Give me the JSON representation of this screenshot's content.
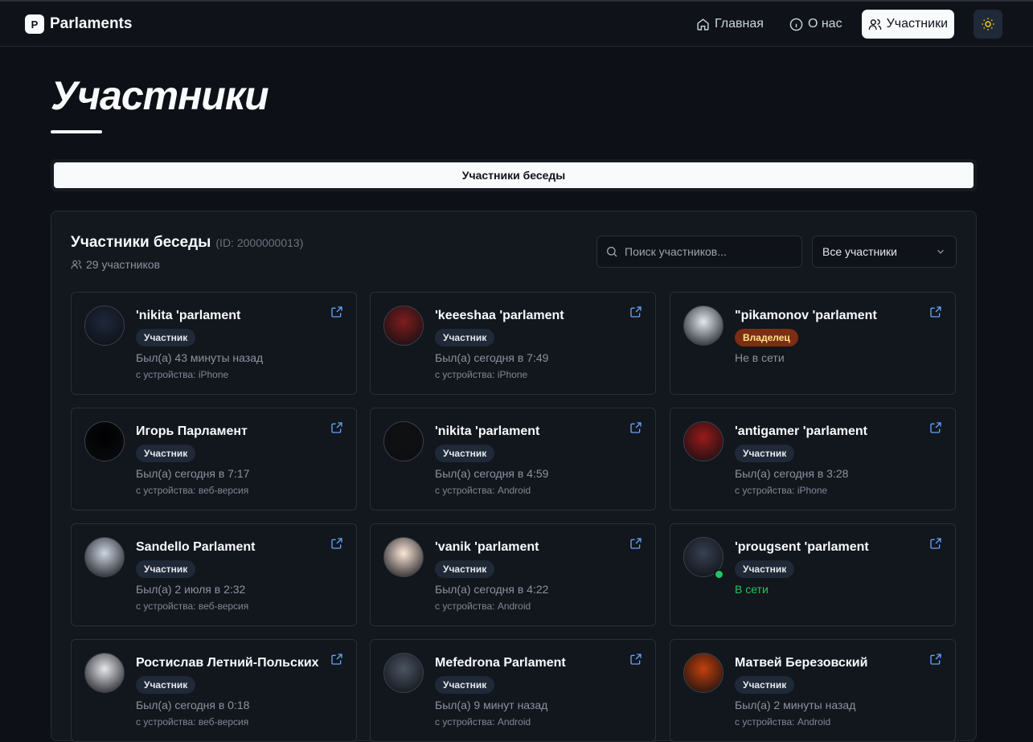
{
  "app": {
    "logo_letter": "P",
    "name": "Parlaments"
  },
  "nav": [
    {
      "label": "Главная",
      "icon": "home-icon"
    },
    {
      "label": "О нас",
      "icon": "info-icon"
    },
    {
      "label": "Участники",
      "icon": "users-icon",
      "active": true
    }
  ],
  "page": {
    "title": "Участники"
  },
  "tabs": [
    {
      "label": "Участники беседы",
      "active": true
    }
  ],
  "panel": {
    "title": "Участники беседы",
    "id_label": "(ID: 2000000013)",
    "count": "29 участников",
    "search_placeholder": "Поиск участников...",
    "filter_value": "Все участники"
  },
  "members": [
    {
      "name": "'nikita 'parlament",
      "role": "Участник",
      "status": "Был(а) 43 минуты назад",
      "device": "с устройства: iPhone",
      "online": false,
      "avatar_color": "#1e293b"
    },
    {
      "name": "'keeeshaa 'parlament",
      "role": "Участник",
      "status": "Был(а) сегодня в 7:49",
      "device": "с устройства: iPhone",
      "online": false,
      "avatar_color": "#7f1d1d"
    },
    {
      "name": "\"pikamonov 'parlament",
      "role": "Владелец",
      "owner": true,
      "status": "Не в сети",
      "device": "",
      "online": false,
      "avatar_color": "#e2e8f0"
    },
    {
      "name": "Игорь Парламент",
      "role": "Участник",
      "status": "Был(а) сегодня в 7:17",
      "device": "с устройства: веб-версия",
      "online": false,
      "avatar_color": "#000000"
    },
    {
      "name": "'nikita 'parlament",
      "role": "Участник",
      "status": "Был(а) сегодня в 4:59",
      "device": "с устройства: Android",
      "online": false,
      "avatar_color": "#111111"
    },
    {
      "name": "'antigamer 'parlament",
      "role": "Участник",
      "status": "Был(а) сегодня в 3:28",
      "device": "с устройства: iPhone",
      "online": false,
      "avatar_color": "#991b1b"
    },
    {
      "name": "Sandello Parlament",
      "role": "Участник",
      "status": "Был(а) 2 июля в 2:32",
      "device": "с устройства: веб-версия",
      "online": false,
      "avatar_color": "#cbd5e1"
    },
    {
      "name": "'vanik 'parlament",
      "role": "Участник",
      "status": "Был(а) сегодня в 4:22",
      "device": "с устройства: Android",
      "online": false,
      "avatar_color": "#fde7d9"
    },
    {
      "name": "'prougsent 'parlament",
      "role": "Участник",
      "status": "В сети",
      "device": "",
      "online": true,
      "avatar_color": "#374151"
    },
    {
      "name": "Ростислав Летний-Польских",
      "role": "Участник",
      "status": "Был(а) сегодня в 0:18",
      "device": "с устройства: веб-версия",
      "online": false,
      "avatar_color": "#e5e7eb"
    },
    {
      "name": "Mefedrona Parlament",
      "role": "Участник",
      "status": "Был(а) 9 минут назад",
      "device": "с устройства: Android",
      "online": false,
      "avatar_color": "#4b5563"
    },
    {
      "name": "Матвей Березовский",
      "role": "Участник",
      "status": "Был(а) 2 минуты назад",
      "device": "с устройства: Android",
      "online": false,
      "avatar_color": "#c2410c"
    }
  ]
}
